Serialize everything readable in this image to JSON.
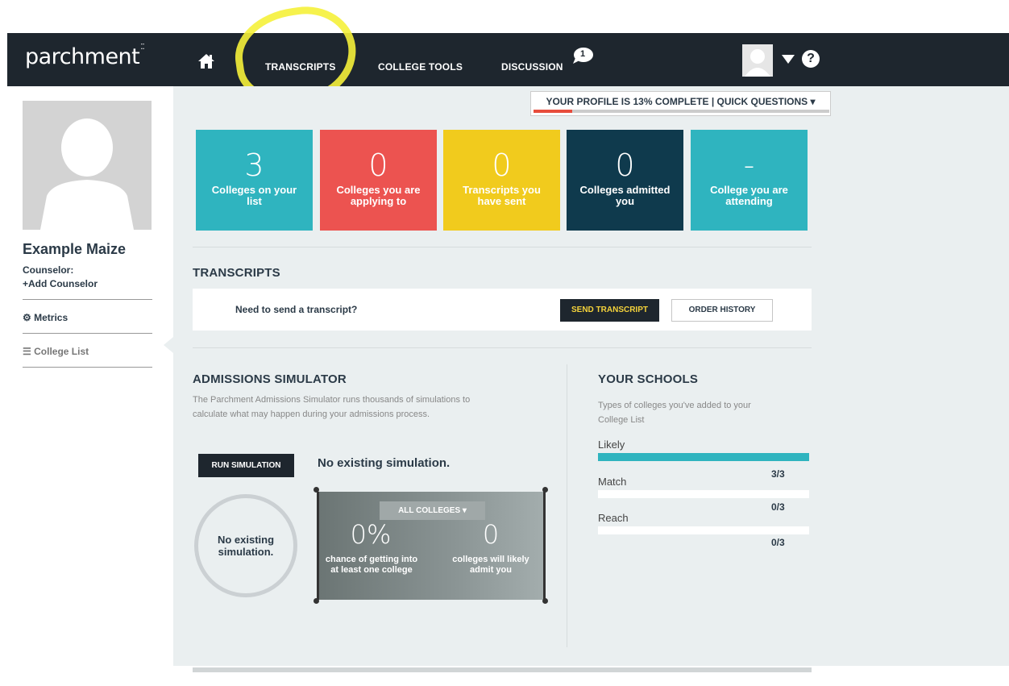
{
  "nav": {
    "brand": "parchment",
    "links": [
      "TRANSCRIPTS",
      "COLLEGE TOOLS",
      "DISCUSSION"
    ],
    "discussion_badge": "1",
    "help_icon": "?",
    "icons": [
      "home-icon",
      "chat-bubble-icon",
      "user-avatar-icon",
      "caret-down-icon",
      "help-icon"
    ]
  },
  "profile": {
    "completion_text": "YOUR PROFILE IS 13% COMPLETE | QUICK QUESTIONS ▾",
    "completion_fraction": 0.13,
    "bar_color": "#e74c3c"
  },
  "sidebar": {
    "name": "Example Maize",
    "counselor_label": "Counselor:",
    "add_counselor": "+Add Counselor",
    "items": [
      {
        "label": "Metrics",
        "icon": "dashboard-icon"
      },
      {
        "label": "College List",
        "icon": "list-icon"
      }
    ]
  },
  "stats": [
    {
      "value": "3",
      "label": "Colleges on your list",
      "color": "#2fb4bf"
    },
    {
      "value": "0",
      "label": "Colleges you are applying to",
      "color": "#ec5350"
    },
    {
      "value": "0",
      "label": "Transcripts you have sent",
      "color": "#f1cb1d"
    },
    {
      "value": "0",
      "label": "Colleges admitted you",
      "color": "#0f3a4d"
    },
    {
      "value": "-",
      "label": "College you are attending",
      "color": "#2fb4bf"
    }
  ],
  "transcripts": {
    "title": "TRANSCRIPTS",
    "question": "Need to send a transcript?",
    "send_button": "SEND TRANSCRIPT",
    "history_button": "ORDER HISTORY"
  },
  "simulator": {
    "title": "ADMISSIONS SIMULATOR",
    "description_line1": "The Parchment Admissions Simulator runs thousands of simulations to",
    "description_line2": "calculate what may happen during your admissions process.",
    "run_button": "RUN SIMULATION",
    "no_sim_title": "No existing simulation.",
    "circle_line1": "No existing",
    "circle_line2": "simulation.",
    "filter": "ALL COLLEGES ▾",
    "chance_value": "0%",
    "chance_label_1": "chance of getting into",
    "chance_label_2": "at least one college",
    "likely_value": "0",
    "likely_label_1": "colleges will likely",
    "likely_label_2": "admit you"
  },
  "schools": {
    "title": "YOUR SCHOOLS",
    "description_line1": "Types of colleges you've added to your",
    "description_line2": "College List",
    "rows": [
      {
        "label": "Likely",
        "count": "3/3",
        "fraction": 1.0
      },
      {
        "label": "Match",
        "count": "0/3",
        "fraction": 0.0
      },
      {
        "label": "Reach",
        "count": "0/3",
        "fraction": 0.0
      }
    ],
    "bar_color": "#2fb4bf"
  }
}
